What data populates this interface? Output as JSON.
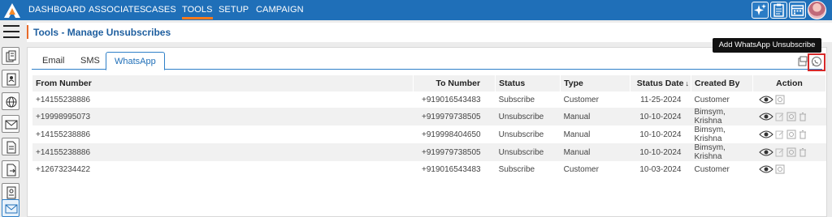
{
  "nav": {
    "items": [
      "DASHBOARD",
      "ASSOCIATES",
      "CASES",
      "TOOLS",
      "SETUP",
      "CAMPAIGN"
    ],
    "active": "TOOLS"
  },
  "page": {
    "title": "Tools - Manage Unsubscribes"
  },
  "tabs": [
    {
      "label": "Email"
    },
    {
      "label": "SMS"
    },
    {
      "label": "WhatsApp"
    }
  ],
  "tooltip": "Add WhatsApp Unsubscribe",
  "table": {
    "headers": {
      "from": "From Number",
      "to": "To Number",
      "status": "Status",
      "type": "Type",
      "status_date": "Status Date",
      "created_by": "Created By",
      "action": "Action"
    },
    "rows": [
      {
        "from": "+14155238886",
        "to": "+919016543483",
        "status": "Subscribe",
        "type": "Customer",
        "date": "11-25-2024",
        "created_by": "Customer"
      },
      {
        "from": "+19998995073",
        "to": "+919979738505",
        "status": "Unsubscribe",
        "type": "Manual",
        "date": "10-10-2024",
        "created_by": "Bimsym, Krishna"
      },
      {
        "from": "+14155238886",
        "to": "+919998404650",
        "status": "Unsubscribe",
        "type": "Manual",
        "date": "10-10-2024",
        "created_by": "Bimsym, Krishna"
      },
      {
        "from": "+14155238886",
        "to": "+919979738505",
        "status": "Unsubscribe",
        "type": "Manual",
        "date": "10-10-2024",
        "created_by": "Bimsym, Krishna"
      },
      {
        "from": "+12673234422",
        "to": "+919016543483",
        "status": "Subscribe",
        "type": "Customer",
        "date": "10-03-2024",
        "created_by": "Customer"
      }
    ]
  },
  "colors": {
    "nav_bg": "#1f6fb8",
    "accent": "#e86a2a",
    "tab_border": "#2f80c8",
    "highlight": "#d62a2a"
  }
}
